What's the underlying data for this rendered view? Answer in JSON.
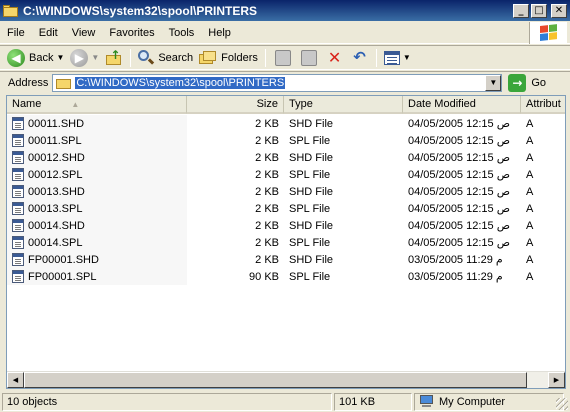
{
  "window": {
    "title": "C:\\WINDOWS\\system32\\spool\\PRINTERS",
    "minimize": "_",
    "maximize": "□",
    "close": "✕"
  },
  "menu": {
    "file": "File",
    "edit": "Edit",
    "view": "View",
    "favorites": "Favorites",
    "tools": "Tools",
    "help": "Help"
  },
  "toolbar": {
    "back": "Back",
    "search": "Search",
    "folders": "Folders"
  },
  "address": {
    "label": "Address",
    "path": "C:\\WINDOWS\\system32\\spool\\PRINTERS",
    "go": "Go"
  },
  "columns": {
    "name": "Name",
    "size": "Size",
    "type": "Type",
    "date": "Date Modified",
    "attributes": "Attribut"
  },
  "files": [
    {
      "name": "00011.SHD",
      "size": "2 KB",
      "type": "SHD File",
      "date": "04/05/2005 12:15 ص",
      "attr": "A"
    },
    {
      "name": "00011.SPL",
      "size": "2 KB",
      "type": "SPL File",
      "date": "04/05/2005 12:15 ص",
      "attr": "A"
    },
    {
      "name": "00012.SHD",
      "size": "2 KB",
      "type": "SHD File",
      "date": "04/05/2005 12:15 ص",
      "attr": "A"
    },
    {
      "name": "00012.SPL",
      "size": "2 KB",
      "type": "SPL File",
      "date": "04/05/2005 12:15 ص",
      "attr": "A"
    },
    {
      "name": "00013.SHD",
      "size": "2 KB",
      "type": "SHD File",
      "date": "04/05/2005 12:15 ص",
      "attr": "A"
    },
    {
      "name": "00013.SPL",
      "size": "2 KB",
      "type": "SPL File",
      "date": "04/05/2005 12:15 ص",
      "attr": "A"
    },
    {
      "name": "00014.SHD",
      "size": "2 KB",
      "type": "SHD File",
      "date": "04/05/2005 12:15 ص",
      "attr": "A"
    },
    {
      "name": "00014.SPL",
      "size": "2 KB",
      "type": "SPL File",
      "date": "04/05/2005 12:15 ص",
      "attr": "A"
    },
    {
      "name": "FP00001.SHD",
      "size": "2 KB",
      "type": "SHD File",
      "date": "03/05/2005 11:29 م",
      "attr": "A"
    },
    {
      "name": "FP00001.SPL",
      "size": "90 KB",
      "type": "SPL File",
      "date": "03/05/2005 11:29 م",
      "attr": "A"
    }
  ],
  "status": {
    "objects": "10 objects",
    "size": "101 KB",
    "location": "My Computer"
  },
  "scroll": {
    "left_arrow": "◀",
    "right_arrow": "▶",
    "thumb_fraction": 0.96
  },
  "icons": {
    "back": "◀",
    "forward": "▶",
    "dropdown": "▼",
    "up_arrow": "↑",
    "delete": "✕",
    "undo": "↶",
    "go": "→",
    "sort": "▲"
  }
}
